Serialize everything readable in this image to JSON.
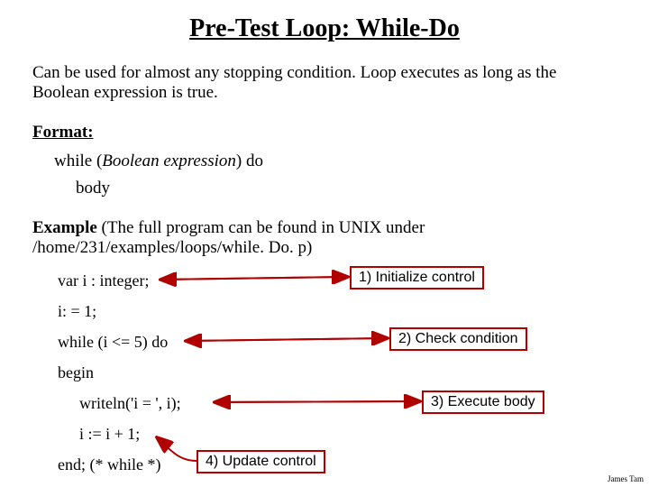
{
  "title": "Pre-Test Loop: While-Do",
  "intro": "Can be used for almost any stopping condition. Loop executes as long as the Boolean expression is true.",
  "format": {
    "heading": "Format:",
    "line_pre": "while (",
    "line_expr": "Boolean expression",
    "line_post": ") do",
    "body": "body"
  },
  "example": {
    "heading_bold": "Example",
    "heading_rest": " (The full program can be found in UNIX under /home/231/examples/loops/while. Do. p)"
  },
  "code": {
    "l1": "var i : integer;",
    "l2": "i: = 1;",
    "l3": "while (i <= 5) do",
    "l4": "begin",
    "l5": "writeln('i = ', i);",
    "l6": "i := i + 1;",
    "l7": "end; (* while *)"
  },
  "callouts": {
    "c1": "1) Initialize control",
    "c2": "2) Check condition",
    "c3": "3) Execute body",
    "c4": "4) Update control"
  },
  "footer": "James Tam"
}
